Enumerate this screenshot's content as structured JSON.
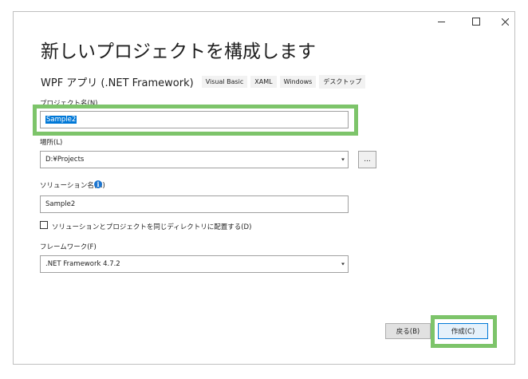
{
  "window": {
    "controls": {
      "minimize_icon": "minimize-icon",
      "maximize_icon": "maximize-icon",
      "close_icon": "close-icon"
    }
  },
  "title": "新しいプロジェクトを構成します",
  "subtitle": "WPF アプリ (.NET Framework)",
  "tags": [
    "Visual Basic",
    "XAML",
    "Windows",
    "デスクトップ"
  ],
  "project_name": {
    "label": "プロジェクト名(N)",
    "value": "Sample2"
  },
  "location": {
    "label": "場所(L)",
    "value": "D:¥Projects",
    "browse_label": "..."
  },
  "solution_name": {
    "label": "ソリューション名(M)",
    "value": "Sample2",
    "info_icon": "info-icon"
  },
  "same_dir_checkbox": {
    "label": "ソリューションとプロジェクトを同じディレクトリに配置する(D)",
    "checked": false
  },
  "framework": {
    "label": "フレームワーク(F)",
    "value": ".NET Framework 4.7.2"
  },
  "buttons": {
    "back": "戻る(B)",
    "create": "作成(C)"
  },
  "colors": {
    "highlight": "#7dc46a",
    "accent": "#0078d7",
    "info": "#1b75d0"
  }
}
